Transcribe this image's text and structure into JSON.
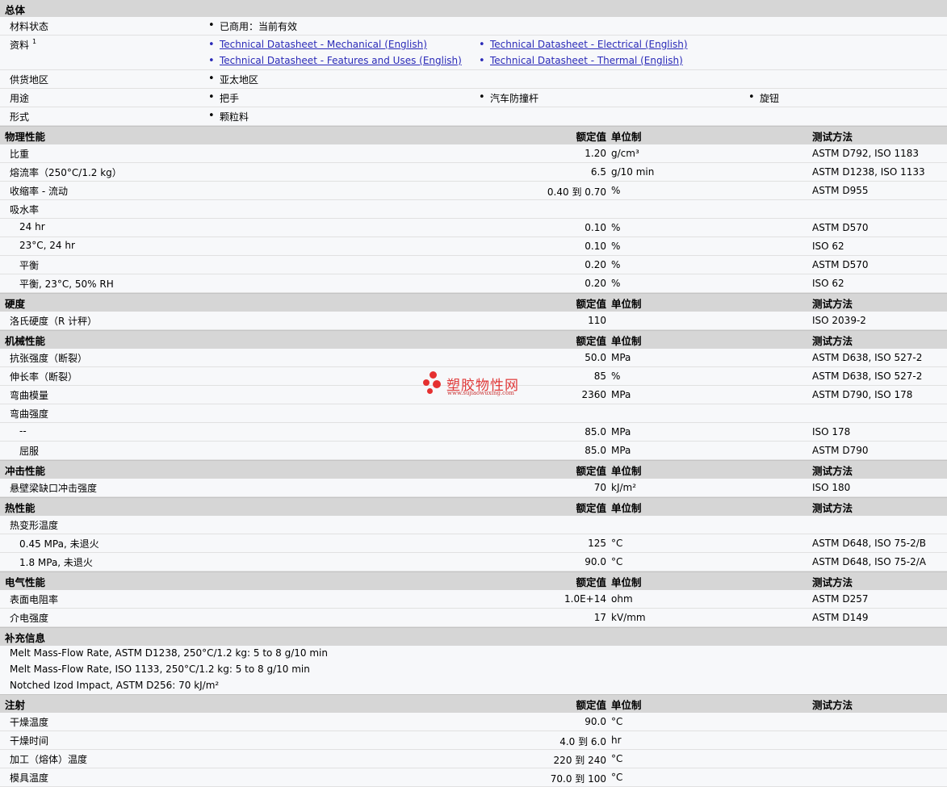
{
  "general": {
    "title": "总体",
    "status_label": "材料状态",
    "status_value": "已商用：当前有效",
    "docs_label": "资料",
    "docs_sup": "1",
    "docs": [
      "Technical Datasheet - Mechanical (English)",
      "Technical Datasheet - Electrical (English)",
      "Technical Datasheet - Features and Uses (English)",
      "Technical Datasheet - Thermal (English)"
    ],
    "region_label": "供货地区",
    "region_value": "亚太地区",
    "use_label": "用途",
    "uses": [
      "把手",
      "汽车防撞杆",
      "旋钮"
    ],
    "form_label": "形式",
    "form_value": "颗粒料"
  },
  "headers": {
    "value": "额定值",
    "unit": "单位制",
    "method": "测试方法"
  },
  "physical": {
    "title": "物理性能",
    "rows": [
      {
        "label": "比重",
        "value": "1.20",
        "unit": "g/cm³",
        "method": "ASTM D792, ISO 1183"
      },
      {
        "label": "熔流率（250°C/1.2 kg）",
        "value": "6.5",
        "unit": "g/10 min",
        "method": "ASTM D1238, ISO 1133"
      },
      {
        "label": "收缩率 - 流动",
        "value": "0.40 到  0.70",
        "unit": "%",
        "method": "ASTM D955"
      },
      {
        "label": "吸水率",
        "value": "",
        "unit": "",
        "method": ""
      },
      {
        "label": "24 hr",
        "value": "0.10",
        "unit": "%",
        "method": "ASTM D570"
      },
      {
        "label": "23°C, 24 hr",
        "value": "0.10",
        "unit": "%",
        "method": "ISO 62"
      },
      {
        "label": "平衡",
        "value": "0.20",
        "unit": "%",
        "method": "ASTM D570"
      },
      {
        "label": "平衡, 23°C, 50% RH",
        "value": "0.20",
        "unit": "%",
        "method": "ISO 62"
      }
    ]
  },
  "hardness": {
    "title": "硬度",
    "rows": [
      {
        "label": "洛氏硬度（R 计秤）",
        "value": "110",
        "unit": "",
        "method": "ISO 2039-2"
      }
    ]
  },
  "mechanical": {
    "title": "机械性能",
    "rows": [
      {
        "label": "抗张强度（断裂）",
        "value": "50.0",
        "unit": "MPa",
        "method": "ASTM D638, ISO 527-2"
      },
      {
        "label": "伸长率（断裂）",
        "value": "85",
        "unit": "%",
        "method": "ASTM D638, ISO 527-2"
      },
      {
        "label": "弯曲模量",
        "value": "2360",
        "unit": "MPa",
        "method": "ASTM D790, ISO 178"
      },
      {
        "label": "弯曲强度",
        "value": "",
        "unit": "",
        "method": ""
      },
      {
        "label": "--",
        "value": "85.0",
        "unit": "MPa",
        "method": "ISO 178"
      },
      {
        "label": "屈服",
        "value": "85.0",
        "unit": "MPa",
        "method": "ASTM D790"
      }
    ]
  },
  "impact": {
    "title": "冲击性能",
    "rows": [
      {
        "label": "悬壁梁缺口冲击强度",
        "value": "70",
        "unit": "kJ/m²",
        "method": "ISO 180"
      }
    ]
  },
  "thermal": {
    "title": "热性能",
    "rows": [
      {
        "label": "热变形温度",
        "value": "",
        "unit": "",
        "method": ""
      },
      {
        "label": "0.45 MPa, 未退火",
        "value": "125",
        "unit": "°C",
        "method": "ASTM D648, ISO 75-2/B"
      },
      {
        "label": "1.8 MPa, 未退火",
        "value": "90.0",
        "unit": "°C",
        "method": "ASTM D648, ISO 75-2/A"
      }
    ]
  },
  "electrical": {
    "title": "电气性能",
    "rows": [
      {
        "label": "表面电阻率",
        "value": "1.0E+14",
        "unit": "ohm",
        "method": "ASTM D257"
      },
      {
        "label": "介电强度",
        "value": "17",
        "unit": "kV/mm",
        "method": "ASTM D149"
      }
    ]
  },
  "supplement": {
    "title": "补充信息",
    "notes": [
      "Melt Mass-Flow Rate, ASTM D1238, 250°C/1.2 kg: 5 to 8 g/10 min",
      "Melt Mass-Flow Rate, ISO 1133, 250°C/1.2 kg: 5 to 8 g/10 min",
      "Notched Izod Impact, ASTM D256: 70 kJ/m²"
    ]
  },
  "injection": {
    "title": "注射",
    "rows": [
      {
        "label": "干燥温度",
        "value": "90.0",
        "unit": "°C",
        "method": ""
      },
      {
        "label": "干燥时间",
        "value": "4.0 到  6.0",
        "unit": "hr",
        "method": ""
      },
      {
        "label": "加工（熔体）温度",
        "value": "220 到  240",
        "unit": "°C",
        "method": ""
      },
      {
        "label": "模具温度",
        "value": "70.0 到  100",
        "unit": "°C",
        "method": ""
      }
    ]
  },
  "watermark": {
    "text": "塑胶物性网",
    "url": "www.sujiaowuxing.com",
    "color": "#e03a3a"
  }
}
